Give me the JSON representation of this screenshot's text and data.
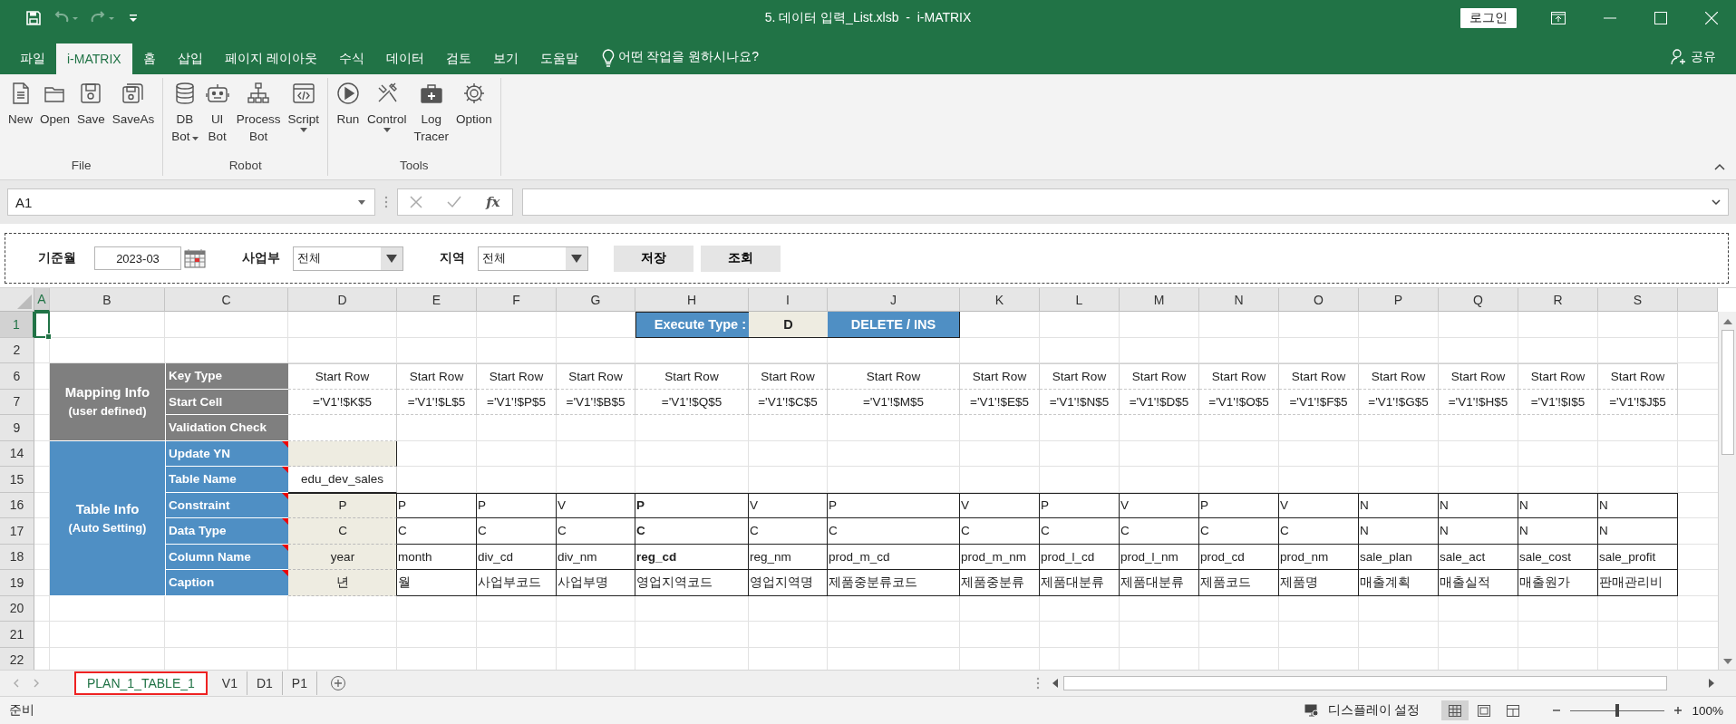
{
  "title_bar": {
    "quick_access": [
      {
        "kind": "save",
        "disabled": false
      },
      {
        "kind": "undo",
        "disabled": true
      },
      {
        "kind": "redo",
        "disabled": true
      }
    ],
    "title": "5. 데이터 입력_List.xlsb  -  i-MATRIX",
    "login_button": "로그인"
  },
  "menu_tabs": [
    {
      "label": "파일",
      "selected": false
    },
    {
      "label": "i-MATRIX",
      "selected": true
    },
    {
      "label": "홈",
      "selected": false
    },
    {
      "label": "삽입",
      "selected": false
    },
    {
      "label": "페이지 레이아웃",
      "selected": false
    },
    {
      "label": "수식",
      "selected": false
    },
    {
      "label": "데이터",
      "selected": false
    },
    {
      "label": "검토",
      "selected": false
    },
    {
      "label": "보기",
      "selected": false
    },
    {
      "label": "도움말",
      "selected": false
    }
  ],
  "tell_me": "어떤 작업을 원하시나요?",
  "share": "공유",
  "ribbon": {
    "groups": [
      {
        "label": "File",
        "buttons": [
          {
            "lines": [
              "New"
            ],
            "dropdown": false
          },
          {
            "lines": [
              "Open"
            ],
            "dropdown": false
          },
          {
            "lines": [
              "Save"
            ],
            "dropdown": false
          },
          {
            "lines": [
              "SaveAs"
            ],
            "dropdown": false
          }
        ]
      },
      {
        "label": "Robot",
        "buttons": [
          {
            "lines": [
              "DB",
              "Bot"
            ],
            "dropdown": true
          },
          {
            "lines": [
              "UI",
              "Bot"
            ],
            "dropdown": false
          },
          {
            "lines": [
              "Process",
              "Bot"
            ],
            "dropdown": false
          },
          {
            "lines": [
              "Script"
            ],
            "dropdown": true
          }
        ]
      },
      {
        "label": "Tools",
        "buttons": [
          {
            "lines": [
              "Run"
            ],
            "dropdown": false
          },
          {
            "lines": [
              "Control"
            ],
            "dropdown": true
          },
          {
            "lines": [
              "Log",
              "Tracer"
            ],
            "dropdown": false
          },
          {
            "lines": [
              "Option"
            ],
            "dropdown": false
          }
        ]
      }
    ]
  },
  "formula_bar": {
    "name_box": "A1",
    "fx": "fx"
  },
  "form": {
    "fields": [
      {
        "kind": "date",
        "label": "기준월",
        "value": "2023-03"
      },
      {
        "kind": "select",
        "label": "사업부",
        "value": "전체"
      },
      {
        "kind": "select",
        "label": "지역",
        "value": "전체"
      }
    ],
    "buttons": [
      "저장",
      "조회"
    ]
  },
  "sheet": {
    "columns": [
      {
        "label": "A",
        "selected": true
      },
      {
        "label": "B",
        "selected": false
      },
      {
        "label": "C",
        "selected": false
      },
      {
        "label": "D",
        "selected": false
      },
      {
        "label": "E",
        "selected": false
      },
      {
        "label": "F",
        "selected": false
      },
      {
        "label": "G",
        "selected": false
      },
      {
        "label": "H",
        "selected": false
      },
      {
        "label": "I",
        "selected": false
      },
      {
        "label": "J",
        "selected": false
      },
      {
        "label": "K",
        "selected": false
      },
      {
        "label": "L",
        "selected": false
      },
      {
        "label": "M",
        "selected": false
      },
      {
        "label": "N",
        "selected": false
      },
      {
        "label": "O",
        "selected": false
      },
      {
        "label": "P",
        "selected": false
      },
      {
        "label": "Q",
        "selected": false
      },
      {
        "label": "R",
        "selected": false
      },
      {
        "label": "S",
        "selected": false
      }
    ],
    "rows": [
      {
        "label": "1",
        "selected": true
      },
      {
        "label": "2",
        "selected": false
      },
      {
        "label": "6",
        "selected": false
      },
      {
        "label": "7",
        "selected": false
      },
      {
        "label": "9",
        "selected": false
      },
      {
        "label": "14",
        "selected": false
      },
      {
        "label": "15",
        "selected": false
      },
      {
        "label": "16",
        "selected": false
      },
      {
        "label": "17",
        "selected": false
      },
      {
        "label": "18",
        "selected": false
      },
      {
        "label": "19",
        "selected": false
      },
      {
        "label": "20",
        "selected": false
      },
      {
        "label": "21",
        "selected": false
      },
      {
        "label": "22",
        "selected": false
      }
    ],
    "execute": {
      "label": "Execute Type :",
      "value": "D",
      "mode": "DELETE / INS"
    },
    "mapping": {
      "title": "Mapping Info",
      "subtitle": "(user defined)",
      "key_type": {
        "label": "Key Type",
        "cells": [
          "Start Row",
          "Start Row",
          "Start Row",
          "Start Row",
          "Start Row",
          "Start Row",
          "Start Row",
          "Start Row",
          "Start Row",
          "Start Row",
          "Start Row",
          "Start Row",
          "Start Row",
          "Start Row",
          "Start Row",
          "Start Row"
        ]
      },
      "start_cell": {
        "label": "Start Cell",
        "cells": [
          "='V1'!$K$5",
          "='V1'!$L$5",
          "='V1'!$P$5",
          "='V1'!$B$5",
          "='V1'!$Q$5",
          "='V1'!$C$5",
          "='V1'!$M$5",
          "='V1'!$E$5",
          "='V1'!$N$5",
          "='V1'!$D$5",
          "='V1'!$O$5",
          "='V1'!$F$5",
          "='V1'!$G$5",
          "='V1'!$H$5",
          "='V1'!$I$5",
          "='V1'!$J$5"
        ]
      },
      "validation": {
        "label": "Validation Check"
      }
    },
    "table_info": {
      "title": "Table Info",
      "subtitle": "(Auto Setting)",
      "comment_marks": true,
      "update_yn": {
        "label": "Update YN"
      },
      "table_name": {
        "label": "Table Name",
        "value": "edu_dev_sales"
      },
      "field_labels": [
        "Constraint",
        "Data Type",
        "Column Name",
        "Caption"
      ],
      "fields": [
        {
          "constraint": "P",
          "data_type": "C",
          "column_name": "year",
          "caption": "년",
          "key": false
        },
        {
          "constraint": "P",
          "data_type": "C",
          "column_name": "month",
          "caption": "월",
          "key": false
        },
        {
          "constraint": "P",
          "data_type": "C",
          "column_name": "div_cd",
          "caption": "사업부코드",
          "key": false
        },
        {
          "constraint": "V",
          "data_type": "C",
          "column_name": "div_nm",
          "caption": "사업부명",
          "key": false
        },
        {
          "constraint": "P",
          "data_type": "C",
          "column_name": "reg_cd",
          "caption": "영업지역코드",
          "key": true
        },
        {
          "constraint": "V",
          "data_type": "C",
          "column_name": "reg_nm",
          "caption": "영업지역명",
          "key": false
        },
        {
          "constraint": "P",
          "data_type": "C",
          "column_name": "prod_m_cd",
          "caption": "제품중분류코드",
          "key": false
        },
        {
          "constraint": "V",
          "data_type": "C",
          "column_name": "prod_m_nm",
          "caption": "제품중분류",
          "key": false
        },
        {
          "constraint": "P",
          "data_type": "C",
          "column_name": "prod_l_cd",
          "caption": "제품대분류",
          "key": false
        },
        {
          "constraint": "V",
          "data_type": "C",
          "column_name": "prod_l_nm",
          "caption": "제품대분류",
          "key": false
        },
        {
          "constraint": "P",
          "data_type": "C",
          "column_name": "prod_cd",
          "caption": "제품코드",
          "key": false
        },
        {
          "constraint": "V",
          "data_type": "C",
          "column_name": "prod_nm",
          "caption": "제품명",
          "key": false
        },
        {
          "constraint": "N",
          "data_type": "N",
          "column_name": "sale_plan",
          "caption": "매출계획",
          "key": false
        },
        {
          "constraint": "N",
          "data_type": "N",
          "column_name": "sale_act",
          "caption": "매출실적",
          "key": false
        },
        {
          "constraint": "N",
          "data_type": "N",
          "column_name": "sale_cost",
          "caption": "매출원가",
          "key": false
        },
        {
          "constraint": "N",
          "data_type": "N",
          "column_name": "sale_profit",
          "caption": "판매관리비",
          "key": false
        }
      ]
    }
  },
  "sheet_tabs": [
    {
      "label": "PLAN_1_TABLE_1",
      "selected": true
    },
    {
      "label": "V1",
      "selected": false
    },
    {
      "label": "D1",
      "selected": false
    },
    {
      "label": "P1",
      "selected": false
    }
  ],
  "status_bar": {
    "text": "준비",
    "display_settings": "디스플레이 설정",
    "views": [
      {
        "kind": "normal",
        "selected": true
      },
      {
        "kind": "page_layout",
        "selected": false
      },
      {
        "kind": "page_break",
        "selected": false
      }
    ],
    "zoom_slider": {
      "level": 0.5
    },
    "zoom": "100%"
  }
}
